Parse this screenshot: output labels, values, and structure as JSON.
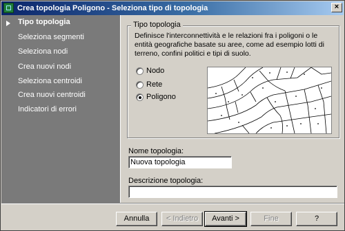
{
  "window": {
    "title": "Crea topologia Poligono - Seleziona tipo di topologia",
    "close_label": "×"
  },
  "steps": [
    {
      "label": "Tipo topologia",
      "active": true
    },
    {
      "label": "Seleziona segmenti",
      "active": false
    },
    {
      "label": "Seleziona nodi",
      "active": false
    },
    {
      "label": "Crea nuovi nodi",
      "active": false
    },
    {
      "label": "Seleziona centroidi",
      "active": false
    },
    {
      "label": "Crea nuovi centroidi",
      "active": false
    },
    {
      "label": "Indicatori di errori",
      "active": false
    }
  ],
  "group": {
    "title": "Tipo topologia",
    "description": "Definisce l'interconnettività e le relazioni fra i poligoni o le entità geografiche basate su aree, come ad esempio lotti di terreno, confini politici e tipi di suolo."
  },
  "radios": [
    {
      "label": "Nodo",
      "checked": false
    },
    {
      "label": "Rete",
      "checked": false
    },
    {
      "label": "Poligono",
      "checked": true
    }
  ],
  "fields": {
    "name_label": "Nome topologia:",
    "name_value": "Nuova topologia",
    "desc_label": "Descrizione topologia:",
    "desc_value": ""
  },
  "buttons": {
    "cancel": "Annulla",
    "back": "< Indietro",
    "next": "Avanti >",
    "finish": "Fine",
    "help": "?"
  }
}
